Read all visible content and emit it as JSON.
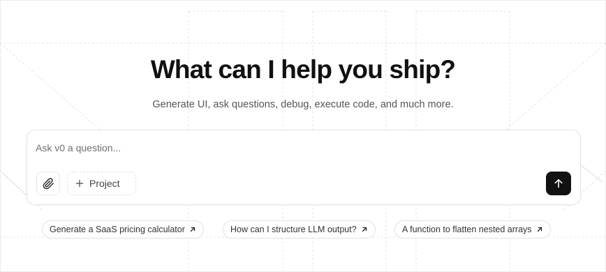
{
  "hero": {
    "title": "What can I help you ship?",
    "subtitle": "Generate UI, ask questions, debug, execute code, and much more."
  },
  "prompt": {
    "placeholder": "Ask v0 a question...",
    "value": "",
    "project_label": "Project"
  },
  "suggestions": [
    {
      "label": "Generate a SaaS pricing calculator"
    },
    {
      "label": "How can I structure LLM output?"
    },
    {
      "label": "A function to flatten nested arrays"
    }
  ],
  "icons": {
    "attach": "paperclip-icon",
    "project": "plus-icon",
    "send": "arrow-up-icon",
    "suggestion": "arrow-up-right-icon"
  },
  "colors": {
    "send_button": "#111111",
    "text": "#171717",
    "muted_text": "#555555"
  }
}
